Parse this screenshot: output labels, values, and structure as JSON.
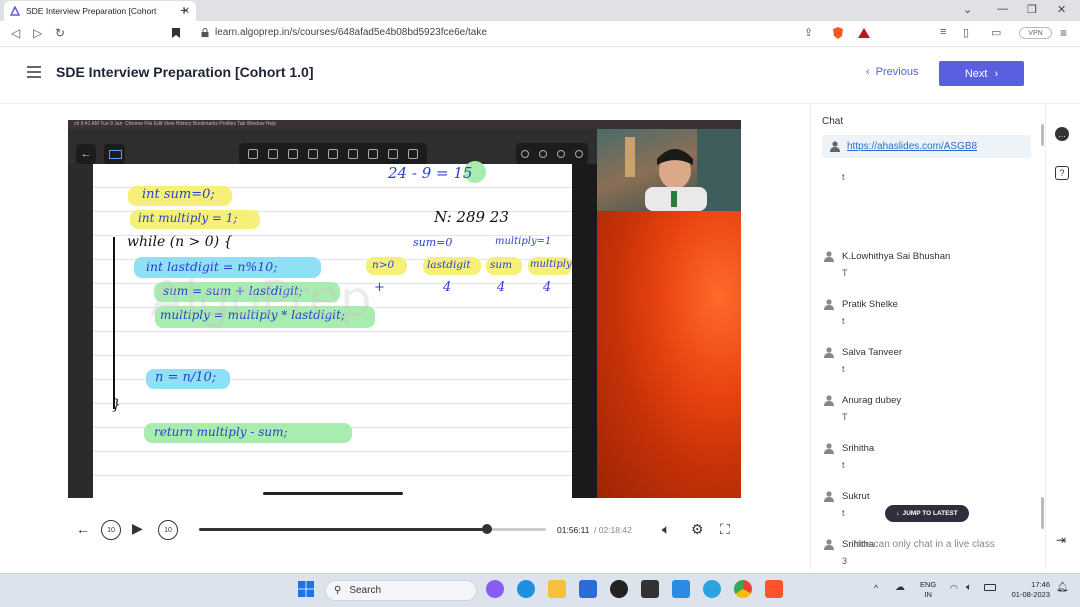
{
  "browser": {
    "tab_title": "SDE Interview Preparation [Cohort",
    "url": "learn.algoprep.in/s/courses/648afad5e4b08bd5923fce6e/take",
    "vpn_label": "VPN"
  },
  "header": {
    "course_title": "SDE Interview Preparation [Cohort 1.0]",
    "previous_label": "Previous",
    "next_label": "Next"
  },
  "video": {
    "mac_menu": "Chrome  File  Edit  View  History  Bookmarks  Profiles  Tab  Window  Help",
    "ipad_status": "ch  9:41 AM  Tue 9 Jan",
    "watermark": "AlgoPrep",
    "notes": {
      "eq": "24 - 9 = 15",
      "n_val": "N: 289  23",
      "l1": "int sum=0;",
      "l2": "int multiply = 1;",
      "l3": "while (n > 0) {",
      "l4": "int lastdigit = n%10;",
      "l5": "sum = sum + lastdigit;",
      "l6": "multiply = multiply * lastdigit;",
      "l7": "n = n/10;",
      "l8": "}",
      "l9": "return multiply - sum;",
      "sum0": "sum=0",
      "mul1": "multiply=1",
      "th1": "n>0",
      "th2": "lastdigit",
      "th3": "sum",
      "th4": "multiply",
      "tv1": "+",
      "tv2": "4",
      "tv3": "4",
      "tv4": "4"
    }
  },
  "player": {
    "current_time": "01:56:11",
    "total_time": "/ 02:18:42",
    "progress": 0.83,
    "skip_back": "10",
    "skip_fwd": "10"
  },
  "chat": {
    "title": "Chat",
    "pinned_link": "https://ahaslides.com/ASGB8",
    "messages": [
      {
        "name": "",
        "text": "t"
      },
      {
        "name": "K.Lowhithya Sai Bhushan",
        "text": "T"
      },
      {
        "name": "Pratik Shelke",
        "text": "t"
      },
      {
        "name": "Salva Tanveer",
        "text": "t"
      },
      {
        "name": "Anurag dubey",
        "text": "T"
      },
      {
        "name": "Srihitha",
        "text": "t"
      },
      {
        "name": "Sukrut",
        "text": "t"
      },
      {
        "name": "Srihitha",
        "text": "3"
      }
    ],
    "jump_label": "JUMP TO LATEST",
    "live_note": "You can only chat in a live class"
  },
  "taskbar": {
    "search_label": "Search",
    "lang_top": "ENG",
    "lang_bottom": "IN",
    "time": "17:46",
    "date": "01-08-2023"
  },
  "colors": {
    "accent": "#5a5fe0",
    "link": "#2a6bd1",
    "highlight_yellow": "#f6f07a",
    "highlight_green": "#a8ecb0",
    "highlight_blue": "#8fe0f5",
    "ink_blue": "#2a3fd0"
  }
}
